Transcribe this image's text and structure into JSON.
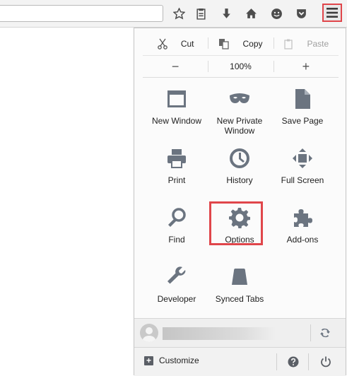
{
  "edit": {
    "cut": "Cut",
    "copy": "Copy",
    "paste": "Paste"
  },
  "zoom": {
    "out": "−",
    "level": "100%",
    "in": "+"
  },
  "tiles": [
    {
      "label": "New Window",
      "icon": "new-window-icon"
    },
    {
      "label": "New Private\nWindow",
      "icon": "private-mask-icon"
    },
    {
      "label": "Save Page",
      "icon": "save-page-icon"
    },
    {
      "label": "Print",
      "icon": "printer-icon"
    },
    {
      "label": "History",
      "icon": "clock-icon"
    },
    {
      "label": "Full Screen",
      "icon": "fullscreen-icon"
    },
    {
      "label": "Find",
      "icon": "magnifier-icon"
    },
    {
      "label": "Options",
      "icon": "gear-icon"
    },
    {
      "label": "Add-ons",
      "icon": "puzzle-icon"
    },
    {
      "label": "Developer",
      "icon": "wrench-icon"
    },
    {
      "label": "Synced Tabs",
      "icon": "synced-tabs-icon"
    }
  ],
  "footer": {
    "customize": "Customize"
  },
  "colors": {
    "highlight": "#e0464b",
    "icon": "#6b7480"
  }
}
